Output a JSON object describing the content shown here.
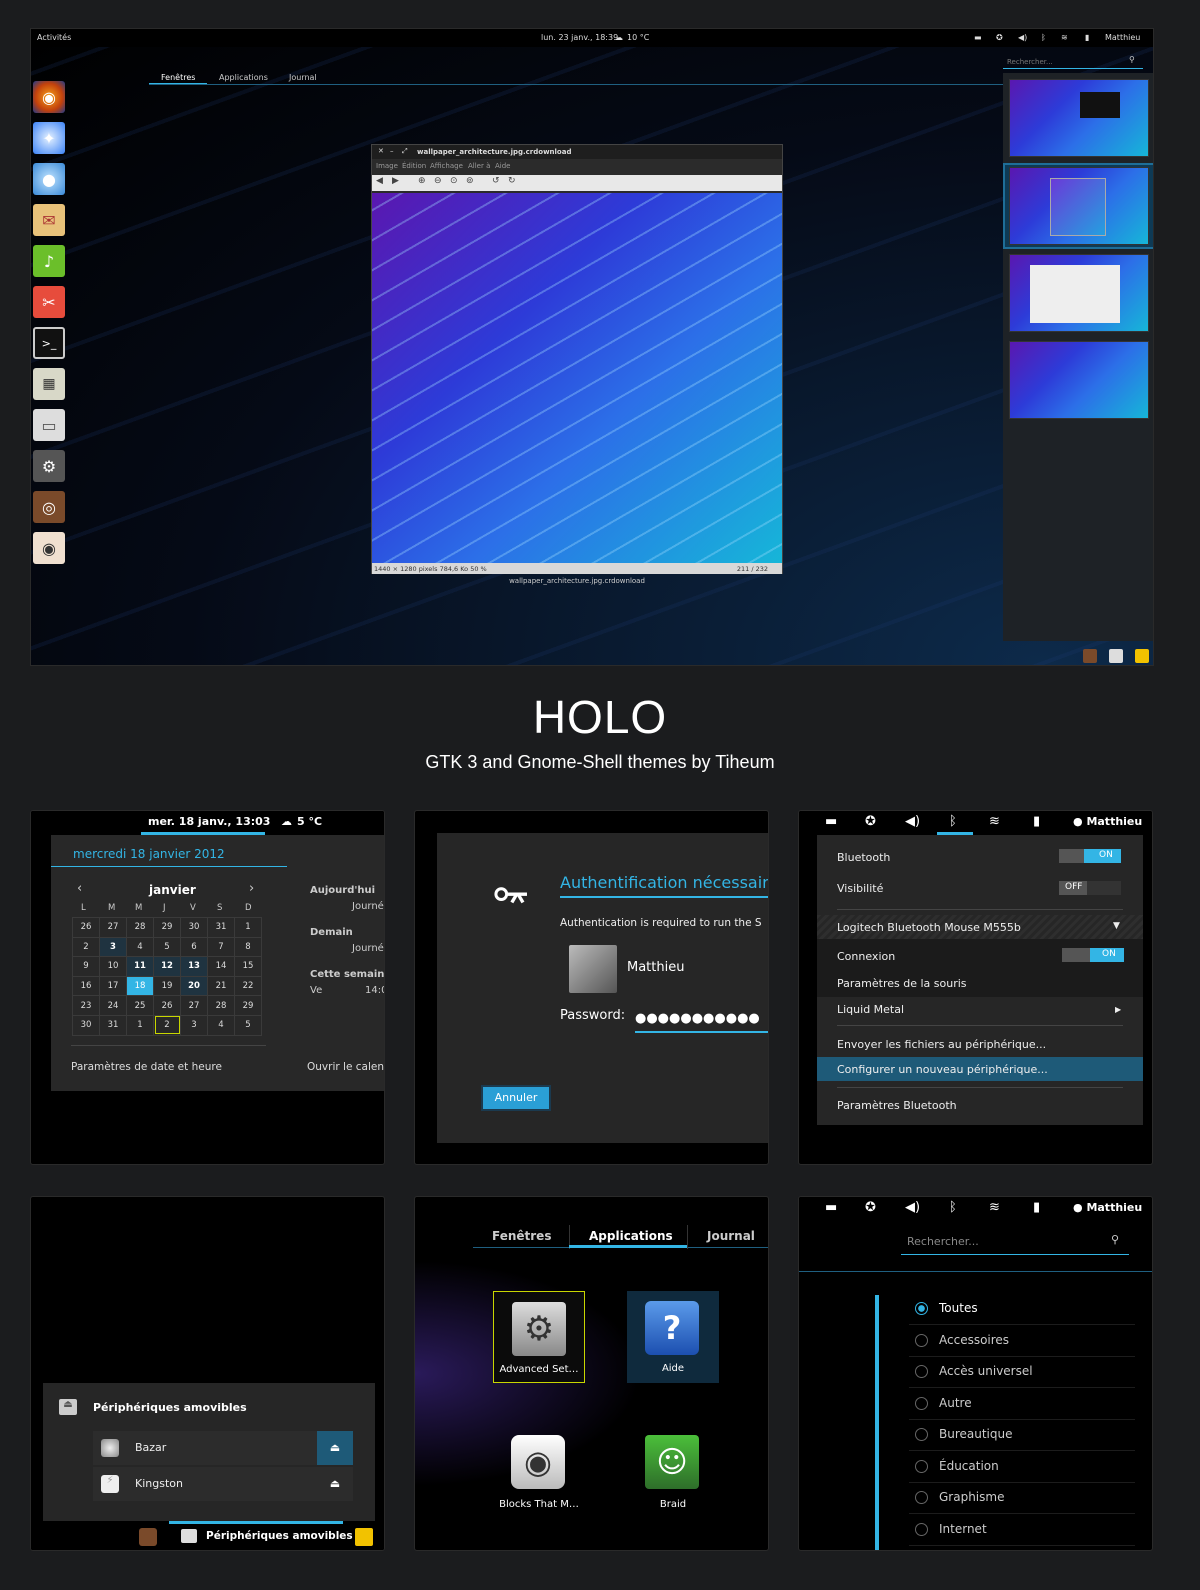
{
  "main": {
    "topbar": {
      "activities": "Activités",
      "clock": "lun. 23 janv., 18:39",
      "weather": "10 °C",
      "user": "Matthieu"
    },
    "tabs": [
      "Fenêtres",
      "Applications",
      "Journal"
    ],
    "search_placeholder": "Rechercher...",
    "window": {
      "title": "wallpaper_architecture.jpg.crdownload",
      "menu": [
        "Image",
        "Édition",
        "Affichage",
        "Aller à",
        "Aide"
      ],
      "status_left": "1440 × 1280 pixels  784,6 Ko    50 %",
      "status_right": "211 / 232",
      "caption": "wallpaper_architecture.jpg.crdownload"
    }
  },
  "header": {
    "title": "HOLO",
    "subtitle": "GTK 3 and Gnome-Shell themes by Tiheum"
  },
  "calendar": {
    "clock": "mer. 18 janv., 13:03",
    "weather": "5 °C",
    "date_long": "mercredi 18 janvier 2012",
    "month": "janvier",
    "weekdays": [
      "L",
      "M",
      "M",
      "J",
      "V",
      "S",
      "D"
    ],
    "rows": [
      [
        "26",
        "27",
        "28",
        "29",
        "30",
        "31",
        "1"
      ],
      [
        "2",
        "3",
        "4",
        "5",
        "6",
        "7",
        "8"
      ],
      [
        "9",
        "10",
        "11",
        "12",
        "13",
        "14",
        "15"
      ],
      [
        "16",
        "17",
        "18",
        "19",
        "20",
        "21",
        "22"
      ],
      [
        "23",
        "24",
        "25",
        "26",
        "27",
        "28",
        "29"
      ],
      [
        "30",
        "31",
        "1",
        "2",
        "3",
        "4",
        "5"
      ]
    ],
    "events": [
      {
        "h": "Aujourd'hui",
        "v": "Journé"
      },
      {
        "h": "Demain",
        "v": "Journé"
      },
      {
        "h": "Cette semaine",
        "d": "Ve",
        "t": "14:0"
      }
    ],
    "footer_left": "Paramètres de date et heure",
    "footer_right": "Ouvrir le calen"
  },
  "auth": {
    "title": "Authentification nécessaire",
    "message": "Authentication is required to run the S",
    "user": "Matthieu",
    "password_label": "Password:",
    "password_mask": "●●●●●●●●●●●",
    "cancel": "Annuler"
  },
  "bluetooth": {
    "user": "Matthieu",
    "bluetooth_label": "Bluetooth",
    "bluetooth_state": "ON",
    "visibility_label": "Visibilité",
    "visibility_state": "OFF",
    "device": "Logitech Bluetooth Mouse M555b",
    "connexion_label": "Connexion",
    "connexion_state": "ON",
    "mouse_settings": "Paramètres de la souris",
    "liquid": "Liquid Metal",
    "send_files": "Envoyer les fichiers au périphérique...",
    "configure": "Configurer un nouveau périphérique...",
    "settings": "Paramètres Bluetooth"
  },
  "removable": {
    "title": "Périphériques amovibles",
    "items": [
      "Bazar",
      "Kingston"
    ],
    "taskbar_label": "Périphériques amovibles"
  },
  "apps": {
    "tabs": [
      "Fenêtres",
      "Applications",
      "Journal"
    ],
    "items": [
      "Advanced Set…",
      "Aide",
      "Blocks That M…",
      "Braid"
    ]
  },
  "categories": {
    "user": "Matthieu",
    "search_placeholder": "Rechercher...",
    "items": [
      "Toutes",
      "Accessoires",
      "Accès universel",
      "Autre",
      "Bureautique",
      "Éducation",
      "Graphisme",
      "Internet"
    ]
  },
  "colors": {
    "accent": "#33b5e5",
    "bg": "#1b1c1e",
    "panel": "#282828"
  }
}
